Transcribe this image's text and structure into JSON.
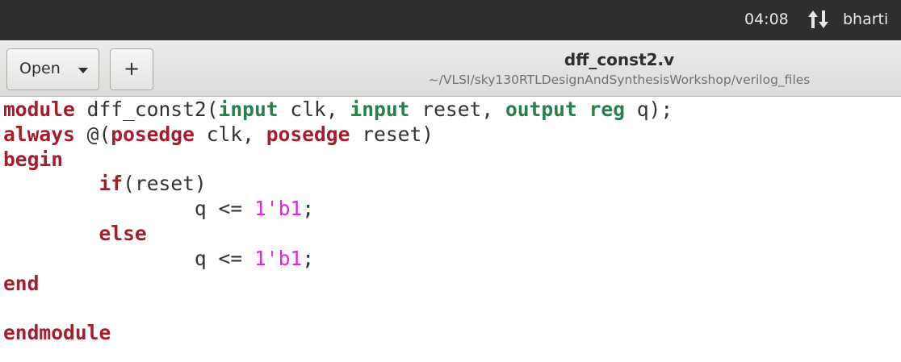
{
  "topbar": {
    "clock": "04:08",
    "network_icon": "network-transfer-icon",
    "user": "bharti"
  },
  "headerbar": {
    "open_label": "Open",
    "new_label": "+",
    "title": "dff_const2.v",
    "subtitle": "~/VLSI/sky130RTLDesignAndSynthesisWorkshop/verilog_files"
  },
  "colors": {
    "keyword": "#a51d2d",
    "type": "#26804a",
    "number": "#e620e6",
    "text": "#2e3436",
    "topbar": "#2e2e2e"
  },
  "code": {
    "lines": [
      [
        {
          "t": "module",
          "c": "kw"
        },
        {
          "t": " dff_const2("
        },
        {
          "t": "input",
          "c": "ty"
        },
        {
          "t": " clk, "
        },
        {
          "t": "input",
          "c": "ty"
        },
        {
          "t": " reset, "
        },
        {
          "t": "output",
          "c": "ty"
        },
        {
          "t": " "
        },
        {
          "t": "reg",
          "c": "ty"
        },
        {
          "t": " q);"
        }
      ],
      [
        {
          "t": "always",
          "c": "kw"
        },
        {
          "t": " @("
        },
        {
          "t": "posedge",
          "c": "kw"
        },
        {
          "t": " clk, "
        },
        {
          "t": "posedge",
          "c": "kw"
        },
        {
          "t": " reset)"
        }
      ],
      [
        {
          "t": "begin",
          "c": "kw"
        }
      ],
      [
        {
          "t": "        "
        },
        {
          "t": "if",
          "c": "kw"
        },
        {
          "t": "(reset)"
        }
      ],
      [
        {
          "t": "                q <= "
        },
        {
          "t": "1'b1",
          "c": "num"
        },
        {
          "t": ";"
        }
      ],
      [
        {
          "t": "        "
        },
        {
          "t": "else",
          "c": "kw"
        }
      ],
      [
        {
          "t": "                q <= "
        },
        {
          "t": "1'b1",
          "c": "num"
        },
        {
          "t": ";"
        }
      ],
      [
        {
          "t": "end",
          "c": "kw"
        }
      ],
      [],
      [
        {
          "t": "endmodule",
          "c": "kw"
        }
      ]
    ]
  }
}
